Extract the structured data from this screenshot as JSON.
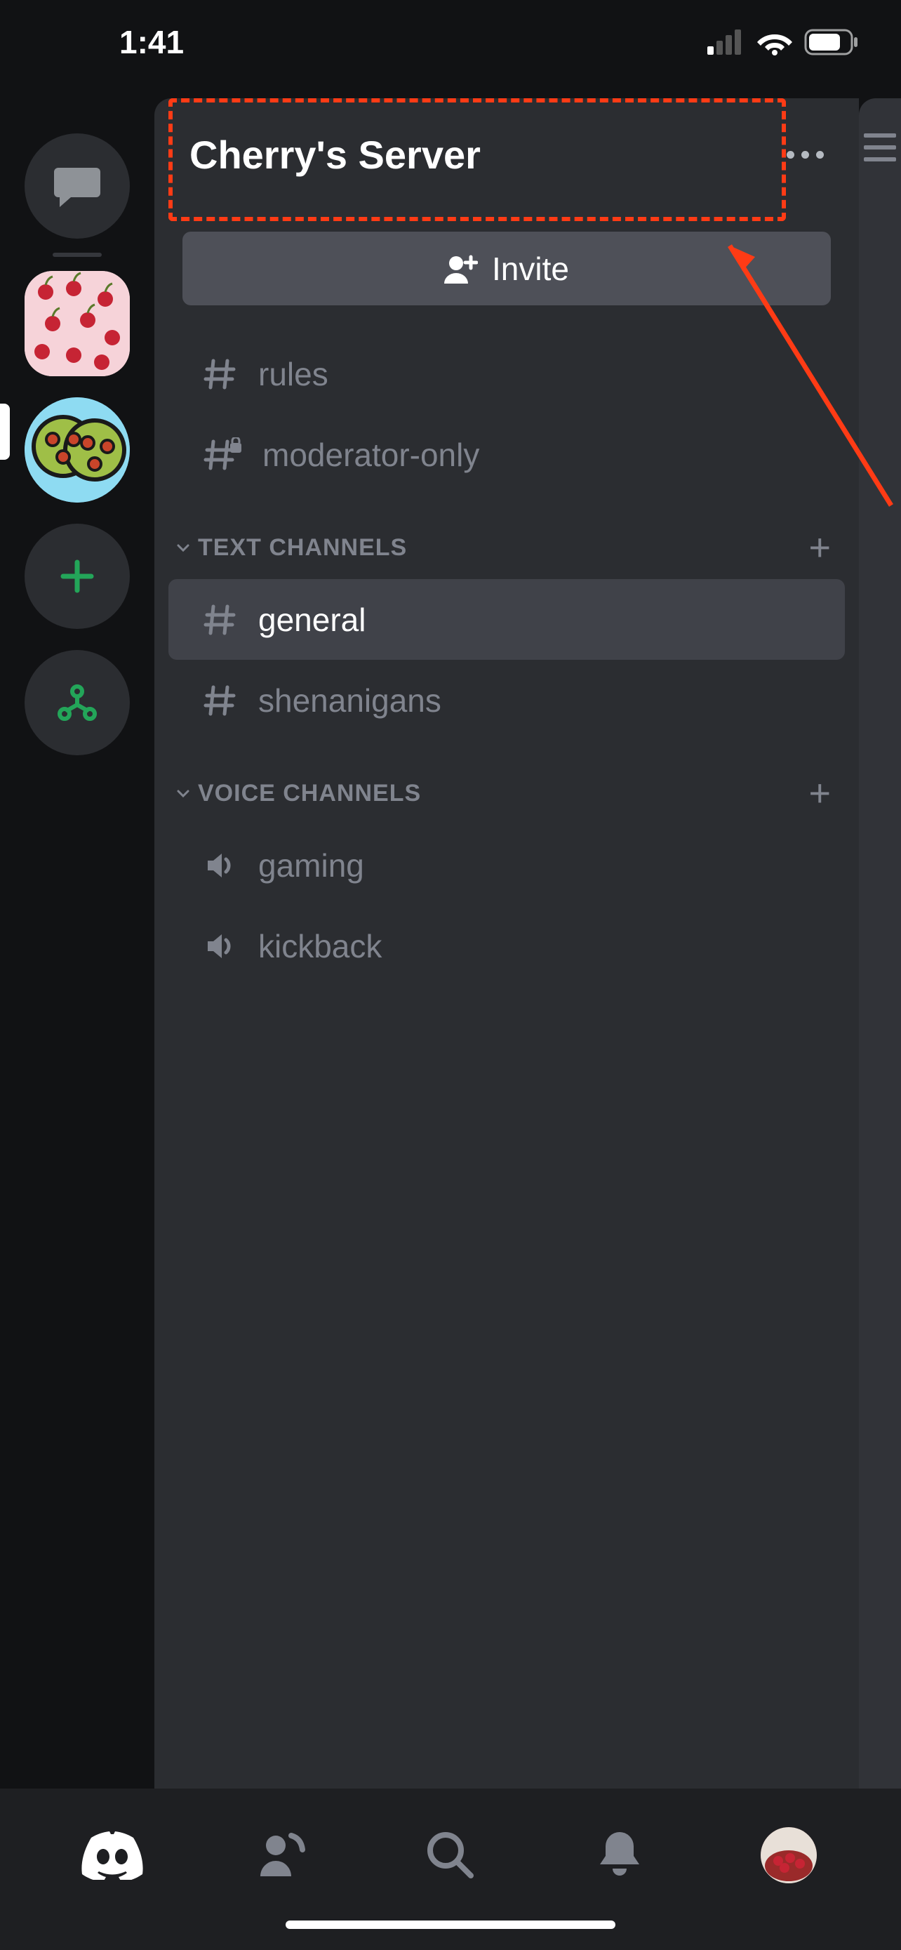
{
  "status": {
    "time": "1:41"
  },
  "server": {
    "name": "Cherry's Server"
  },
  "invite": {
    "label": "Invite"
  },
  "top_channels": [
    {
      "name": "rules",
      "locked": false
    },
    {
      "name": "moderator-only",
      "locked": true
    }
  ],
  "categories": [
    {
      "label": "TEXT CHANNELS",
      "type": "text",
      "channels": [
        {
          "name": "general",
          "active": true
        },
        {
          "name": "shenanigans",
          "active": false
        }
      ]
    },
    {
      "label": "VOICE CHANNELS",
      "type": "voice",
      "channels": [
        {
          "name": "gaming"
        },
        {
          "name": "kickback"
        }
      ]
    }
  ]
}
